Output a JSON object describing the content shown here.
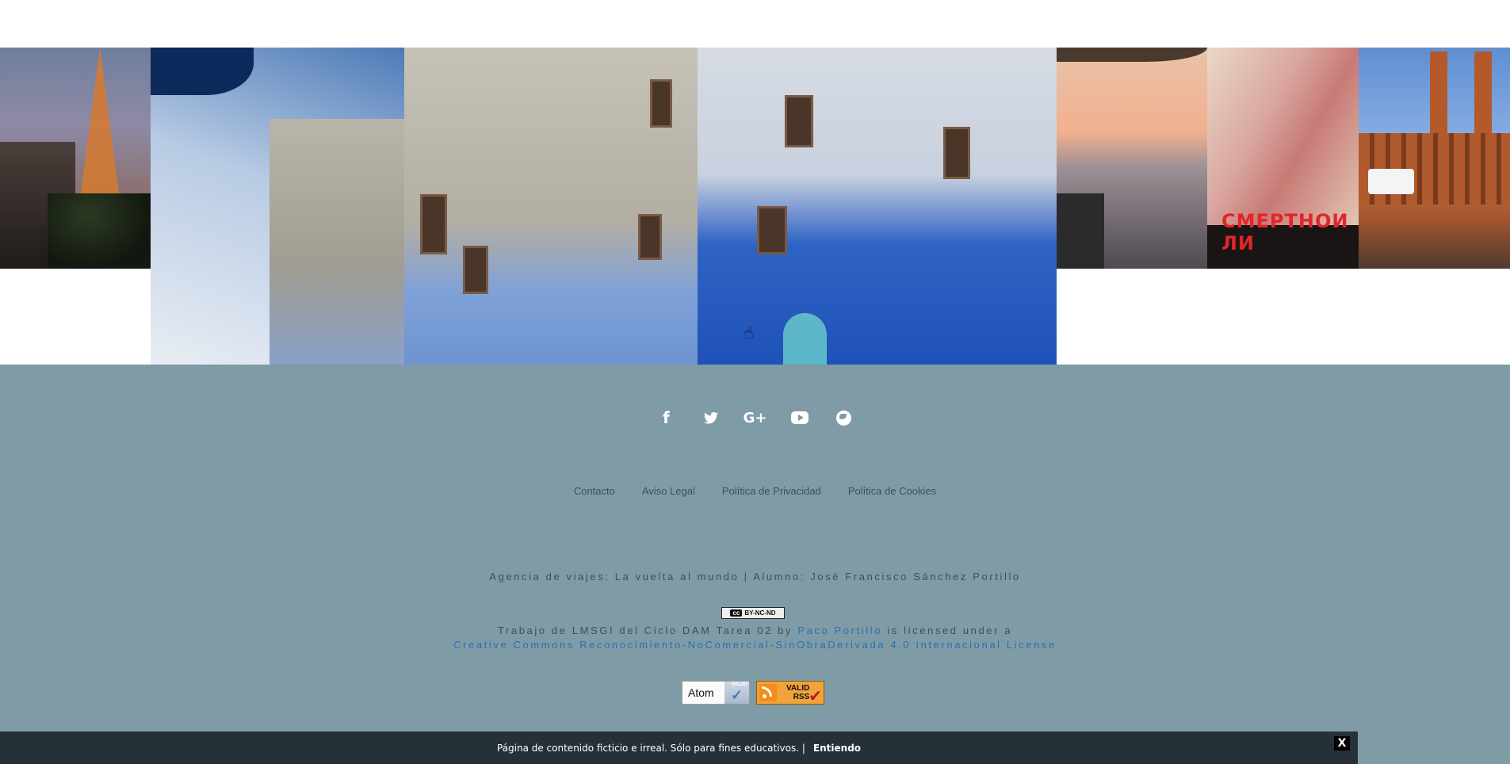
{
  "gallery": {
    "images": [
      {
        "name": "eiffel-tower-photo"
      },
      {
        "name": "blue-town-photo"
      },
      {
        "name": "sunset-beach-photo"
      },
      {
        "name": "kiss-mural-photo",
        "mural_text": "СМЕРТНОИ ЛИ"
      },
      {
        "name": "berlin-bridge-photo"
      }
    ]
  },
  "footer": {
    "social_icons": [
      "facebook-icon",
      "twitter-icon",
      "google-plus-icon",
      "youtube-icon",
      "globe-icon"
    ],
    "social_glyphs": {
      "facebook": "f",
      "twitter": "•",
      "gplus": "G+"
    },
    "links": [
      "Contacto",
      "Aviso Legal",
      "Política de Privacidad",
      "Política de Cookies"
    ],
    "credit": "Agencia de viajes: La vuelta al mundo | Alumno: José Francisco Sánchez Portillo",
    "cc_badge": "BY-NC-ND",
    "cc_badge_mark": "cc",
    "license_prefix": "Trabajo de LMSGI del Ciclo DAM Tarea 02 by",
    "license_author": "Paco Portillo",
    "license_middle": "is licensed under a",
    "license_name": "Creative Commons Reconocimiento-NoComercial-SinObraDerivada 4.0 Internacional License",
    "atom_badge": {
      "label": "Atom",
      "valid": "VALID"
    },
    "rss_badge": {
      "line1": "VALID",
      "line2": "RSS"
    }
  },
  "cookie_bar": {
    "message": "Página de contenido ficticio e irreal. Sólo para fines educativos. |",
    "accept": "Entiendo",
    "close": "X"
  },
  "colors": {
    "footer_bg": "#7f9ca6",
    "cookie_bg": "#263137",
    "link_blue": "#2a6fb0"
  }
}
